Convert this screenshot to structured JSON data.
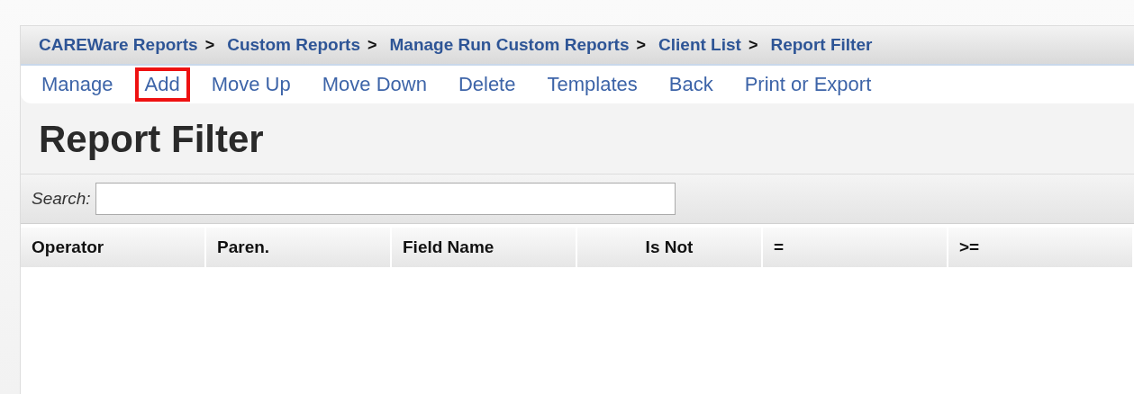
{
  "breadcrumbs": [
    {
      "label": "CAREWare Reports",
      "separator": ">"
    },
    {
      "label": "Custom Reports",
      "separator": ">"
    },
    {
      "label": "Manage Run Custom Reports",
      "separator": ">"
    },
    {
      "label": "Client List",
      "separator": ">"
    },
    {
      "label": "Report Filter"
    }
  ],
  "menu": [
    {
      "label": "Manage",
      "highlighted": false
    },
    {
      "label": "Add",
      "highlighted": true
    },
    {
      "label": "Move Up",
      "highlighted": false
    },
    {
      "label": "Move Down",
      "highlighted": false
    },
    {
      "label": "Delete",
      "highlighted": false
    },
    {
      "label": "Templates",
      "highlighted": false
    },
    {
      "label": "Back",
      "highlighted": false
    },
    {
      "label": "Print or Export",
      "highlighted": false
    }
  ],
  "page_title": "Report Filter",
  "search": {
    "label": "Search:"
  },
  "table": {
    "columns": [
      {
        "label": "Operator",
        "kind": "text"
      },
      {
        "label": "Paren.",
        "kind": "text"
      },
      {
        "label": "Field Name",
        "kind": "text"
      },
      {
        "label": "Is Not",
        "kind": "flag"
      },
      {
        "label": "=",
        "kind": "text"
      },
      {
        "label": ">=",
        "kind": "text"
      }
    ]
  }
}
